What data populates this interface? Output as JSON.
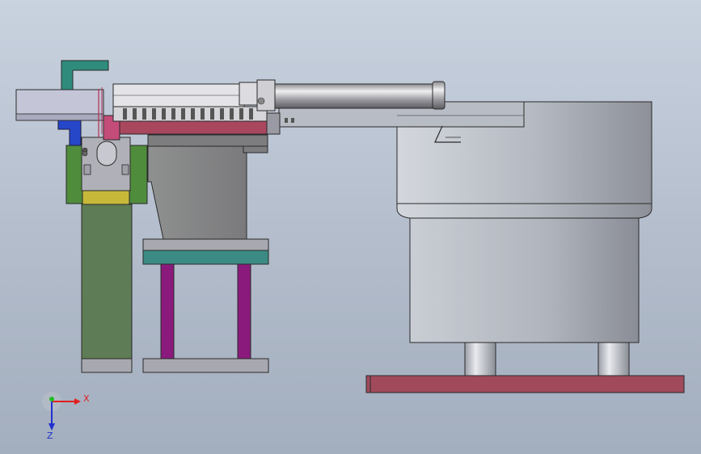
{
  "axes": {
    "x_label": "X",
    "z_label": "Z"
  },
  "colors": {
    "background_top": "#c9d2df",
    "background_bottom": "#a3aebe",
    "edge": "#2a2a2a",
    "bowl_body": "#b9bec6",
    "bowl_shade": "#8e949c",
    "base_plate": "#a04a5c",
    "teal": "#2f8c7c",
    "pink_rail": "#a8475e",
    "blue_part": "#2647c8",
    "olive_column": "#5e7c55",
    "yellow_block": "#c8b83a",
    "green_clamp": "#4f8c3c",
    "purple_leg": "#8a1a7c",
    "teal_plate": "#3c8a84",
    "grey_part": "#a8a8b0",
    "lavender_block": "#c4c6d8",
    "axis_x": "#e02020",
    "axis_y": "#20c020",
    "axis_z": "#2030d0"
  }
}
